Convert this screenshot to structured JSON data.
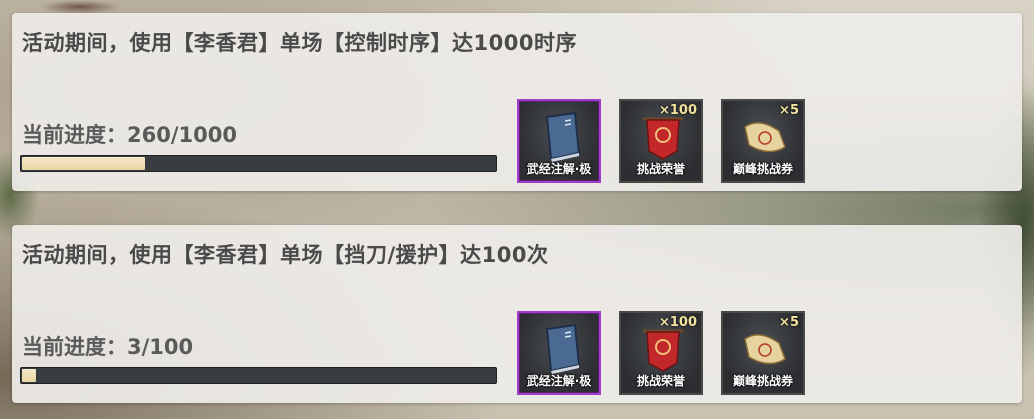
{
  "tasks": [
    {
      "title": "活动期间，使用【李香君】单场【控制时序】达1000时序",
      "progress_label": "当前进度：260/1000",
      "progress": {
        "current": 260,
        "target": 1000
      },
      "rewards": [
        {
          "name": "武经注解·极",
          "qty": "",
          "icon": "book-icon",
          "rarity": "purple"
        },
        {
          "name": "挑战荣誉",
          "qty": "×100",
          "icon": "red-banner-icon",
          "rarity": "normal"
        },
        {
          "name": "巅峰挑战券",
          "qty": "×5",
          "icon": "scroll-ticket-icon",
          "rarity": "normal"
        }
      ]
    },
    {
      "title": "活动期间，使用【李香君】单场【挡刀/援护】达100次",
      "progress_label": "当前进度：3/100",
      "progress": {
        "current": 3,
        "target": 100
      },
      "rewards": [
        {
          "name": "武经注解·极",
          "qty": "",
          "icon": "book-icon",
          "rarity": "purple"
        },
        {
          "name": "挑战荣誉",
          "qty": "×100",
          "icon": "red-banner-icon",
          "rarity": "normal"
        },
        {
          "name": "巅峰挑战券",
          "qty": "×5",
          "icon": "scroll-ticket-icon",
          "rarity": "normal"
        }
      ]
    }
  ],
  "colors": {
    "panel_bg": "#eeece8",
    "progress_fill": "#f0e0b8",
    "progress_track": "#3a3d40",
    "rare_border": "#a23dcb",
    "qty_text": "#f2e3a0"
  }
}
